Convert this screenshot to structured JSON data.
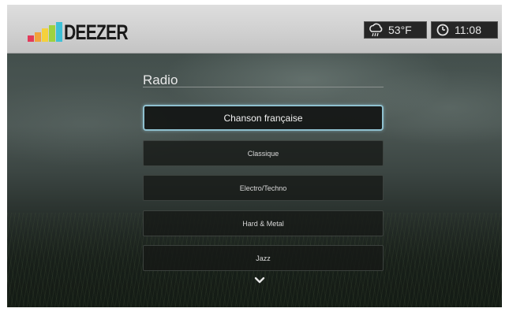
{
  "app": {
    "logo_text": "DEEZER",
    "logo_colors": [
      "#e33a5a",
      "#f2a23b",
      "#f5d13c",
      "#9ed23f",
      "#3ec0d6"
    ]
  },
  "status": {
    "temperature": "53°F",
    "weather_icon": "weather-cloud-icon",
    "time": "11:08",
    "time_icon": "clock-icon"
  },
  "page": {
    "title": "Radio"
  },
  "menu": {
    "items": [
      {
        "label": "Chanson française",
        "selected": true
      },
      {
        "label": "Classique",
        "selected": false
      },
      {
        "label": "Electro/Techno",
        "selected": false
      },
      {
        "label": "Hard & Metal",
        "selected": false
      },
      {
        "label": "Jazz",
        "selected": false
      }
    ],
    "more_icon": "chevron-down-icon"
  },
  "colors": {
    "focus_border": "#8fc0cf",
    "topbar_background": "#d2d2d2"
  }
}
